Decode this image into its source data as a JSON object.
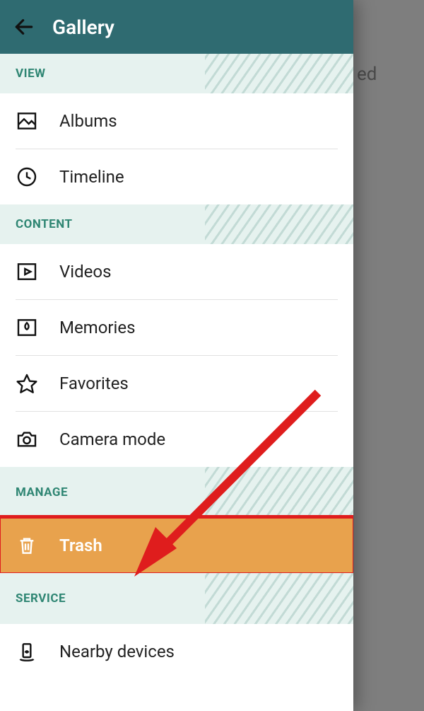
{
  "header": {
    "title": "Gallery"
  },
  "background": {
    "peek_text": "ed"
  },
  "sections": {
    "view": {
      "label": "VIEW",
      "items": [
        {
          "label": "Albums"
        },
        {
          "label": "Timeline"
        }
      ]
    },
    "content": {
      "label": "CONTENT",
      "items": [
        {
          "label": "Videos"
        },
        {
          "label": "Memories"
        },
        {
          "label": "Favorites"
        },
        {
          "label": "Camera mode"
        }
      ]
    },
    "manage": {
      "label": "MANAGE",
      "items": [
        {
          "label": "Trash"
        }
      ]
    },
    "service": {
      "label": "SERVICE",
      "items": [
        {
          "label": "Nearby devices"
        }
      ]
    }
  },
  "highlight_color": "#e8a24d",
  "callout_color": "#df1d1d"
}
